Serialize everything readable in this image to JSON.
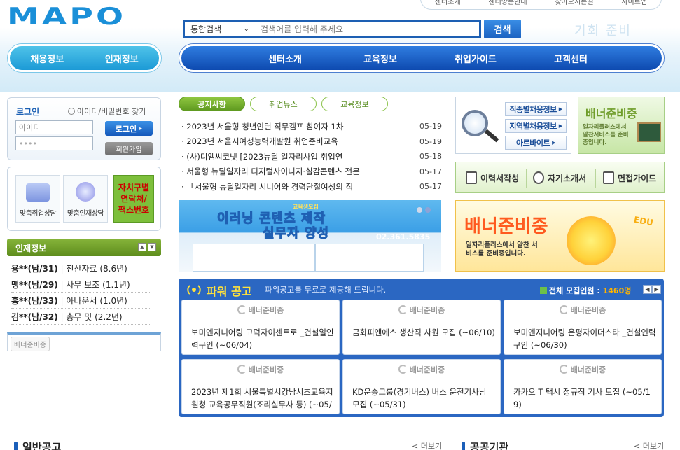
{
  "header": {
    "logo": "MAPO",
    "top_util": [
      "센터소개",
      "센터방문안내",
      "찾아오시는길",
      "사이트맵"
    ],
    "search": {
      "category": "통합검색",
      "placeholder": "검색어를 입력해 주세요",
      "button": "검색"
    },
    "decor_text": "기회 준비"
  },
  "left_nav": [
    "채용정보",
    "인재정보"
  ],
  "main_nav": [
    "센터소개",
    "교육정보",
    "취업가이드",
    "고객센터"
  ],
  "login": {
    "title": "로그인",
    "find_link": "아이디/비밀번호 찾기",
    "id_placeholder": "아이디",
    "pw_value": "••••",
    "login_button": "로그인",
    "join_button": "회원가입"
  },
  "quick_menu": {
    "items": [
      "맞춤취업상담",
      "맞춤인재상담"
    ],
    "region_contact": [
      "자치구별",
      "연락처/",
      "팩스번호"
    ]
  },
  "talent": {
    "title": "인재정보",
    "rows": [
      {
        "name": "용**(남/31)",
        "info": "| 전산자료 (8.6년)"
      },
      {
        "name": "맹**(남/29)",
        "info": "| 사무 보조 (1.1년)"
      },
      {
        "name": "홍**(남/33)",
        "info": "| 아나운서 (1.0년)"
      },
      {
        "name": "김**(남/32)",
        "info": "| 총무 및 (2.2년)"
      }
    ]
  },
  "left_banner": "배너준비중",
  "news": {
    "tabs": [
      "공지사항",
      "취업뉴스",
      "교육정보"
    ],
    "items": [
      {
        "title": "· 2023년 서울형 청년인턴 직무캠프 참여자 1차",
        "date": "05-19"
      },
      {
        "title": "· 2023년 서울시여성능력개발원 취업준비교육",
        "date": "05-19"
      },
      {
        "title": "· (사)디엠씨코넷 [2023뉴딜 일자리사업 취업연",
        "date": "05-18"
      },
      {
        "title": "· 서울형 뉴딜일자리 디지털사이니지·실감콘텐츠 전문",
        "date": "05-17"
      },
      {
        "title": "· 「서울형 뉴딜일자리 시니어와 경력단절여성의 직",
        "date": "05-17"
      }
    ]
  },
  "edu_banner": {
    "tag": "교육생모집",
    "line1": "이러닝 콘텐츠 제작",
    "line2": "실무자 양성",
    "phone": "02.361.5835"
  },
  "power_job": {
    "title": "파워 공고",
    "subtitle": "파워공고를 무료로 제공해 드립니다.",
    "total_label": "전체 모집인원 :",
    "total_value": "1460명",
    "ready_label": "배너준비중",
    "cards": [
      "보미엔지니어링 고덕자이센트로 _건설일인력구인 (~06/04)",
      "금화피앤에스 생산직 사원 모집 (~06/10)",
      "보미엔지니어링 은평자이더스타 _건설인력구인 (~06/30)",
      "2023년 제1회 서울특별시강남서초교육지원청 교육공무직원(조리실무사 등) (~05/25)",
      "KD운송그룹(경기버스) 버스 운전기사님 모집 (~05/31)",
      "카카오 T 택시 정규직 기사 모집 (~05/19)"
    ]
  },
  "job_info": [
    "직종별채용정보",
    "지역별채용정보",
    "아르바이트"
  ],
  "banner_ready_small": {
    "title": "배너준비중",
    "desc": "일자리플러스에서 알찬서비스를 준비중입니다."
  },
  "guide": [
    "이력서작성",
    "자기소개서",
    "면접가이드"
  ],
  "banner_ready_large": {
    "title": "배너준비중",
    "desc": "일자리플러스에서 알찬 서비스를 준비중입니다.",
    "edu": "EDU"
  },
  "bottom": {
    "general_notice": "일반공고",
    "public_org": "공공기관",
    "more": "< 더보기"
  }
}
